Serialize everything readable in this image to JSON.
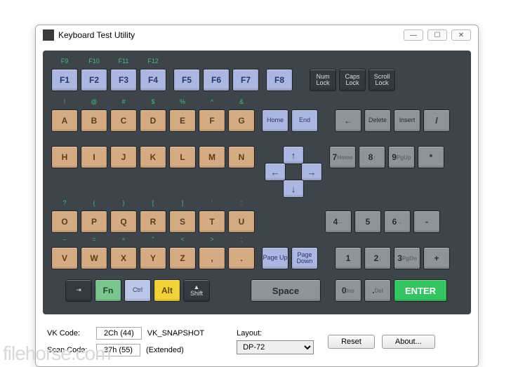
{
  "window": {
    "title": "Keyboard Test Utility"
  },
  "top_labels": [
    "F9",
    "F10",
    "F11",
    "F12"
  ],
  "fkeys": [
    "F1",
    "F2",
    "F3",
    "F4",
    "F5",
    "F6",
    "F7",
    "F8"
  ],
  "locks": [
    "Num Lock",
    "Caps Lock",
    "Scroll Lock"
  ],
  "sym_row1": [
    "!",
    "@",
    "#",
    "$",
    "%",
    "^",
    "&"
  ],
  "alpha1": [
    "A",
    "B",
    "C",
    "D",
    "E",
    "F",
    "G"
  ],
  "nav1": [
    "Home",
    "End"
  ],
  "num_r1": {
    "back": "←",
    "del": "Delete",
    "ins": "Insert",
    "slash": "/"
  },
  "alpha2": [
    "H",
    "I",
    "J",
    "K",
    "L",
    "M",
    "N"
  ],
  "num_r2": [
    {
      "n": "7",
      "s": "Home"
    },
    {
      "n": "8",
      "s": "↑"
    },
    {
      "n": "9",
      "s": "PgUp"
    },
    {
      "n": "*",
      "s": ""
    }
  ],
  "sym_row3": [
    "?",
    "{",
    "}",
    "[",
    "]",
    "'",
    ":"
  ],
  "alpha3": [
    "O",
    "P",
    "Q",
    "R",
    "S",
    "T",
    "U"
  ],
  "num_r3": [
    {
      "n": "4",
      "s": "←"
    },
    {
      "n": "5",
      "s": ""
    },
    {
      "n": "6",
      "s": "→"
    },
    {
      "n": "-",
      "s": ""
    }
  ],
  "sym_row4": [
    "–",
    "=",
    "+",
    "\"",
    "<",
    ">",
    ";"
  ],
  "alpha4": [
    "V",
    "W",
    "X",
    "Y",
    "Z",
    ",",
    "."
  ],
  "nav4": [
    "Page Up",
    "Page Down"
  ],
  "num_r4": [
    {
      "n": "1",
      "s": ""
    },
    {
      "n": "2",
      "s": "↓"
    },
    {
      "n": "3",
      "s": "PgDn"
    },
    {
      "n": "+",
      "s": ""
    }
  ],
  "mods": {
    "tab": "⇥",
    "fn": "Fn",
    "ctrl": "Ctrl",
    "alt": "Alt",
    "shift": "▲\nShift",
    "space": "Space",
    "enter": "ENTER"
  },
  "num_r5": [
    {
      "n": "0",
      "s": "Ins"
    },
    {
      "n": ".",
      "s": "Del"
    }
  ],
  "arrows": {
    "up": "↑",
    "down": "↓",
    "left": "←",
    "right": "→"
  },
  "info": {
    "vk_label": "VK Code:",
    "vk_value": "2Ch (44)",
    "vk_name": "VK_SNAPSHOT",
    "scan_label": "Scan Code:",
    "scan_value": "37h (55)",
    "scan_ext": "(Extended)"
  },
  "layout": {
    "label": "Layout:",
    "value": "DP-72"
  },
  "buttons": {
    "reset": "Reset",
    "about": "About..."
  },
  "watermark": "filehorse.com"
}
